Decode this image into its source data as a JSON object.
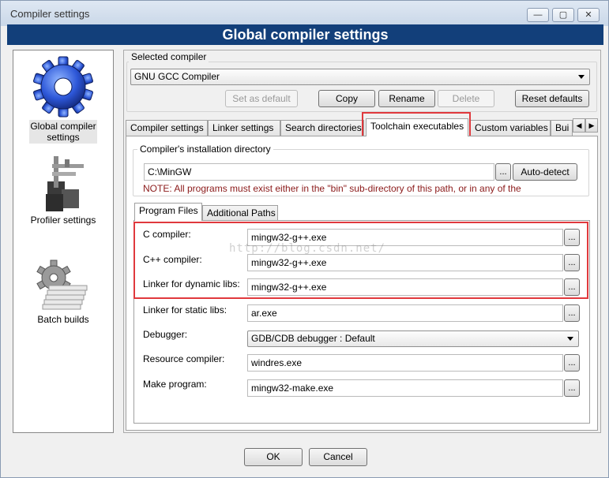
{
  "window": {
    "title": "Compiler settings",
    "minimize_glyph": "—",
    "restore_glyph": "▢",
    "close_glyph": "✕"
  },
  "header": {
    "title": "Global compiler settings"
  },
  "sidebar": {
    "items": [
      {
        "label_line1": "Global compiler",
        "label_line2": "settings",
        "icon": "gear-icon",
        "selected": true
      },
      {
        "label": "Profiler settings",
        "icon": "profiler-icon"
      },
      {
        "label": "Batch builds",
        "icon": "batch-builds-icon"
      }
    ]
  },
  "compiler_group": {
    "legend": "Selected compiler",
    "selected_compiler": "GNU GCC Compiler",
    "buttons": {
      "set_default": "Set as default",
      "copy": "Copy",
      "rename": "Rename",
      "delete": "Delete",
      "reset_defaults": "Reset defaults"
    }
  },
  "tabs": [
    {
      "label": "Compiler settings"
    },
    {
      "label": "Linker settings"
    },
    {
      "label": "Search directories"
    },
    {
      "label": "Toolchain executables",
      "active": true
    },
    {
      "label": "Custom variables"
    },
    {
      "label": "Bui"
    }
  ],
  "install_dir": {
    "legend": "Compiler's installation directory",
    "value": "C:\\MinGW",
    "browse_label": "...",
    "autodetect_label": "Auto-detect",
    "note": "NOTE: All programs must exist either in the \"bin\" sub-directory of this path, or in any of the"
  },
  "subtabs": [
    {
      "label": "Program Files",
      "active": true
    },
    {
      "label": "Additional Paths"
    }
  ],
  "programs": {
    "browse_label": "...",
    "c_compiler": {
      "label": "C compiler:",
      "value": "mingw32-g++.exe"
    },
    "cpp_compiler": {
      "label": "C++ compiler:",
      "value": "mingw32-g++.exe"
    },
    "linker_dynamic": {
      "label": "Linker for dynamic libs:",
      "value": "mingw32-g++.exe"
    },
    "linker_static": {
      "label": "Linker for static libs:",
      "value": "ar.exe"
    },
    "debugger": {
      "label": "Debugger:",
      "value": "GDB/CDB debugger : Default"
    },
    "resource_compiler": {
      "label": "Resource compiler:",
      "value": "windres.exe"
    },
    "make_program": {
      "label": "Make program:",
      "value": "mingw32-make.exe"
    }
  },
  "watermark": "http://blog.csdn.net/",
  "footer": {
    "ok": "OK",
    "cancel": "Cancel"
  },
  "colors": {
    "header_bg": "#123f7a",
    "highlight_box": "#e0393d",
    "note_text": "#8b1a1a"
  }
}
